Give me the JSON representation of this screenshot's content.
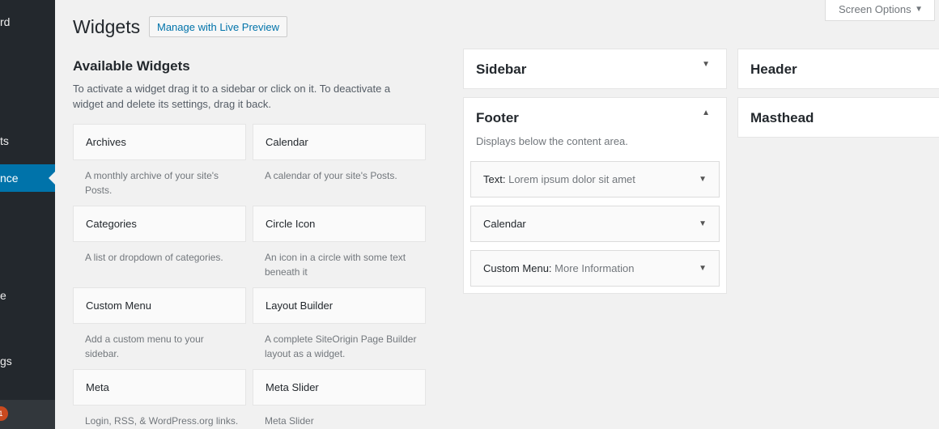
{
  "admin_menu": {
    "items": [
      {
        "label": "rd"
      },
      {
        "label": "ts"
      },
      {
        "label": "nce"
      },
      {
        "label": "e"
      },
      {
        "label": "gs"
      }
    ],
    "update_count": "1"
  },
  "header": {
    "title": "Widgets",
    "action_label": "Manage with Live Preview",
    "screen_options": "Screen Options"
  },
  "available": {
    "title": "Available Widgets",
    "description": "To activate a widget drag it to a sidebar or click on it. To deactivate a widget and delete its settings, drag it back.",
    "widgets": [
      {
        "name": "Archives",
        "desc": "A monthly archive of your site's Posts."
      },
      {
        "name": "Calendar",
        "desc": "A calendar of your site's Posts."
      },
      {
        "name": "Categories",
        "desc": "A list or dropdown of categories."
      },
      {
        "name": "Circle Icon",
        "desc": "An icon in a circle with some text beneath it"
      },
      {
        "name": "Custom Menu",
        "desc": "Add a custom menu to your sidebar."
      },
      {
        "name": "Layout Builder",
        "desc": "A complete SiteOrigin Page Builder layout as a widget."
      },
      {
        "name": "Meta",
        "desc": "Login, RSS, & WordPress.org links."
      },
      {
        "name": "Meta Slider",
        "desc": "Meta Slider"
      }
    ]
  },
  "sidebars": {
    "sidebar": {
      "title": "Sidebar"
    },
    "footer": {
      "title": "Footer",
      "description": "Displays below the content area.",
      "widgets": [
        {
          "type": "Text:",
          "title": "Lorem ipsum dolor sit amet"
        },
        {
          "type": "Calendar",
          "title": ""
        },
        {
          "type": "Custom Menu:",
          "title": "More Information"
        }
      ]
    },
    "header": {
      "title": "Header"
    },
    "masthead": {
      "title": "Masthead"
    }
  }
}
